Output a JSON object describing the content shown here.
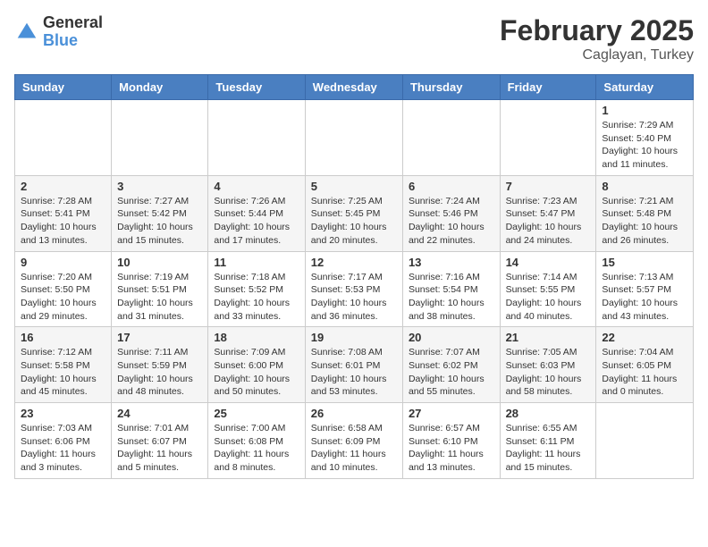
{
  "header": {
    "logo_general": "General",
    "logo_blue": "Blue",
    "month_title": "February 2025",
    "location": "Caglayan, Turkey"
  },
  "days_of_week": [
    "Sunday",
    "Monday",
    "Tuesday",
    "Wednesday",
    "Thursday",
    "Friday",
    "Saturday"
  ],
  "weeks": [
    [
      {
        "day": "",
        "info": ""
      },
      {
        "day": "",
        "info": ""
      },
      {
        "day": "",
        "info": ""
      },
      {
        "day": "",
        "info": ""
      },
      {
        "day": "",
        "info": ""
      },
      {
        "day": "",
        "info": ""
      },
      {
        "day": "1",
        "info": "Sunrise: 7:29 AM\nSunset: 5:40 PM\nDaylight: 10 hours\nand 11 minutes."
      }
    ],
    [
      {
        "day": "2",
        "info": "Sunrise: 7:28 AM\nSunset: 5:41 PM\nDaylight: 10 hours\nand 13 minutes."
      },
      {
        "day": "3",
        "info": "Sunrise: 7:27 AM\nSunset: 5:42 PM\nDaylight: 10 hours\nand 15 minutes."
      },
      {
        "day": "4",
        "info": "Sunrise: 7:26 AM\nSunset: 5:44 PM\nDaylight: 10 hours\nand 17 minutes."
      },
      {
        "day": "5",
        "info": "Sunrise: 7:25 AM\nSunset: 5:45 PM\nDaylight: 10 hours\nand 20 minutes."
      },
      {
        "day": "6",
        "info": "Sunrise: 7:24 AM\nSunset: 5:46 PM\nDaylight: 10 hours\nand 22 minutes."
      },
      {
        "day": "7",
        "info": "Sunrise: 7:23 AM\nSunset: 5:47 PM\nDaylight: 10 hours\nand 24 minutes."
      },
      {
        "day": "8",
        "info": "Sunrise: 7:21 AM\nSunset: 5:48 PM\nDaylight: 10 hours\nand 26 minutes."
      }
    ],
    [
      {
        "day": "9",
        "info": "Sunrise: 7:20 AM\nSunset: 5:50 PM\nDaylight: 10 hours\nand 29 minutes."
      },
      {
        "day": "10",
        "info": "Sunrise: 7:19 AM\nSunset: 5:51 PM\nDaylight: 10 hours\nand 31 minutes."
      },
      {
        "day": "11",
        "info": "Sunrise: 7:18 AM\nSunset: 5:52 PM\nDaylight: 10 hours\nand 33 minutes."
      },
      {
        "day": "12",
        "info": "Sunrise: 7:17 AM\nSunset: 5:53 PM\nDaylight: 10 hours\nand 36 minutes."
      },
      {
        "day": "13",
        "info": "Sunrise: 7:16 AM\nSunset: 5:54 PM\nDaylight: 10 hours\nand 38 minutes."
      },
      {
        "day": "14",
        "info": "Sunrise: 7:14 AM\nSunset: 5:55 PM\nDaylight: 10 hours\nand 40 minutes."
      },
      {
        "day": "15",
        "info": "Sunrise: 7:13 AM\nSunset: 5:57 PM\nDaylight: 10 hours\nand 43 minutes."
      }
    ],
    [
      {
        "day": "16",
        "info": "Sunrise: 7:12 AM\nSunset: 5:58 PM\nDaylight: 10 hours\nand 45 minutes."
      },
      {
        "day": "17",
        "info": "Sunrise: 7:11 AM\nSunset: 5:59 PM\nDaylight: 10 hours\nand 48 minutes."
      },
      {
        "day": "18",
        "info": "Sunrise: 7:09 AM\nSunset: 6:00 PM\nDaylight: 10 hours\nand 50 minutes."
      },
      {
        "day": "19",
        "info": "Sunrise: 7:08 AM\nSunset: 6:01 PM\nDaylight: 10 hours\nand 53 minutes."
      },
      {
        "day": "20",
        "info": "Sunrise: 7:07 AM\nSunset: 6:02 PM\nDaylight: 10 hours\nand 55 minutes."
      },
      {
        "day": "21",
        "info": "Sunrise: 7:05 AM\nSunset: 6:03 PM\nDaylight: 10 hours\nand 58 minutes."
      },
      {
        "day": "22",
        "info": "Sunrise: 7:04 AM\nSunset: 6:05 PM\nDaylight: 11 hours\nand 0 minutes."
      }
    ],
    [
      {
        "day": "23",
        "info": "Sunrise: 7:03 AM\nSunset: 6:06 PM\nDaylight: 11 hours\nand 3 minutes."
      },
      {
        "day": "24",
        "info": "Sunrise: 7:01 AM\nSunset: 6:07 PM\nDaylight: 11 hours\nand 5 minutes."
      },
      {
        "day": "25",
        "info": "Sunrise: 7:00 AM\nSunset: 6:08 PM\nDaylight: 11 hours\nand 8 minutes."
      },
      {
        "day": "26",
        "info": "Sunrise: 6:58 AM\nSunset: 6:09 PM\nDaylight: 11 hours\nand 10 minutes."
      },
      {
        "day": "27",
        "info": "Sunrise: 6:57 AM\nSunset: 6:10 PM\nDaylight: 11 hours\nand 13 minutes."
      },
      {
        "day": "28",
        "info": "Sunrise: 6:55 AM\nSunset: 6:11 PM\nDaylight: 11 hours\nand 15 minutes."
      },
      {
        "day": "",
        "info": ""
      }
    ]
  ]
}
